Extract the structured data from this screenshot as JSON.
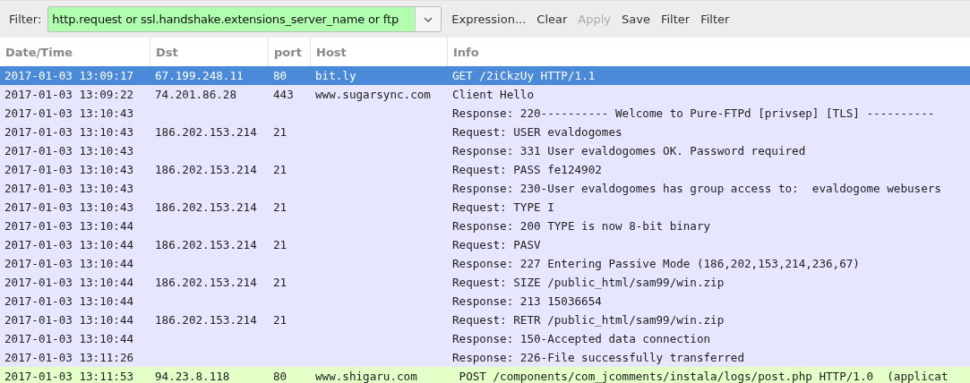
{
  "filter_bar": {
    "label": "Filter:",
    "value": "http.request or ssl.handshake.extensions_server_name or ftp",
    "buttons": [
      {
        "label": "Expression...",
        "disabled": false
      },
      {
        "label": "Clear",
        "disabled": false
      },
      {
        "label": "Apply",
        "disabled": true
      },
      {
        "label": "Save",
        "disabled": false
      },
      {
        "label": "Filter",
        "disabled": false
      },
      {
        "label": "Filter",
        "disabled": false
      }
    ]
  },
  "table": {
    "columns": [
      "Date/Time",
      "Dst",
      "port",
      "Host",
      "Info"
    ],
    "rows": [
      {
        "cells": [
          "2017-01-03 13:09:17",
          "67.199.248.11",
          "80",
          "bit.ly",
          "GET /2iCkzUy HTTP/1.1"
        ],
        "selected": true,
        "color": "#4a8ad8"
      },
      {
        "cells": [
          "2017-01-03 13:09:22",
          "74.201.86.28",
          "443",
          "www.sugarsync.com",
          "Client Hello"
        ],
        "selected": false,
        "color": "#e7e6ff"
      },
      {
        "cells": [
          "2017-01-03 13:10:43",
          "",
          "",
          "",
          "Response: 220---------- Welcome to Pure-FTPd [privsep] [TLS] ----------"
        ],
        "selected": false,
        "color": "#e7e6ff"
      },
      {
        "cells": [
          "2017-01-03 13:10:43",
          "186.202.153.214",
          "21",
          "",
          "Request: USER evaldogomes"
        ],
        "selected": false,
        "color": "#e7e6ff"
      },
      {
        "cells": [
          "2017-01-03 13:10:43",
          "",
          "",
          "",
          "Response: 331 User evaldogomes OK. Password required"
        ],
        "selected": false,
        "color": "#e7e6ff"
      },
      {
        "cells": [
          "2017-01-03 13:10:43",
          "186.202.153.214",
          "21",
          "",
          "Request: PASS fe124902"
        ],
        "selected": false,
        "color": "#e7e6ff"
      },
      {
        "cells": [
          "2017-01-03 13:10:43",
          "",
          "",
          "",
          "Response: 230-User evaldogomes has group access to:  evaldogome webusers"
        ],
        "selected": false,
        "color": "#e7e6ff"
      },
      {
        "cells": [
          "2017-01-03 13:10:43",
          "186.202.153.214",
          "21",
          "",
          "Request: TYPE I"
        ],
        "selected": false,
        "color": "#e7e6ff"
      },
      {
        "cells": [
          "2017-01-03 13:10:44",
          "",
          "",
          "",
          "Response: 200 TYPE is now 8-bit binary"
        ],
        "selected": false,
        "color": "#e7e6ff"
      },
      {
        "cells": [
          "2017-01-03 13:10:44",
          "186.202.153.214",
          "21",
          "",
          "Request: PASV"
        ],
        "selected": false,
        "color": "#e7e6ff"
      },
      {
        "cells": [
          "2017-01-03 13:10:44",
          "",
          "",
          "",
          "Response: 227 Entering Passive Mode (186,202,153,214,236,67)"
        ],
        "selected": false,
        "color": "#e7e6ff"
      },
      {
        "cells": [
          "2017-01-03 13:10:44",
          "186.202.153.214",
          "21",
          "",
          "Request: SIZE /public_html/sam99/win.zip"
        ],
        "selected": false,
        "color": "#e7e6ff"
      },
      {
        "cells": [
          "2017-01-03 13:10:44",
          "",
          "",
          "",
          "Response: 213 15036654"
        ],
        "selected": false,
        "color": "#e7e6ff"
      },
      {
        "cells": [
          "2017-01-03 13:10:44",
          "186.202.153.214",
          "21",
          "",
          "Request: RETR /public_html/sam99/win.zip"
        ],
        "selected": false,
        "color": "#e7e6ff"
      },
      {
        "cells": [
          "2017-01-03 13:10:44",
          "",
          "",
          "",
          "Response: 150-Accepted data connection"
        ],
        "selected": false,
        "color": "#e7e6ff"
      },
      {
        "cells": [
          "2017-01-03 13:11:26",
          "",
          "",
          "",
          "Response: 226-File successfully transferred"
        ],
        "selected": false,
        "color": "#e7e6ff"
      },
      {
        "cells": [
          "2017-01-03 13:11:53",
          "94.23.8.118",
          "80",
          "www.shigaru.com",
          " POST /components/com_jcomments/instala/logs/post.php HTTP/1.0  (applicat"
        ],
        "selected": false,
        "color": "#e4ffc7"
      }
    ]
  }
}
